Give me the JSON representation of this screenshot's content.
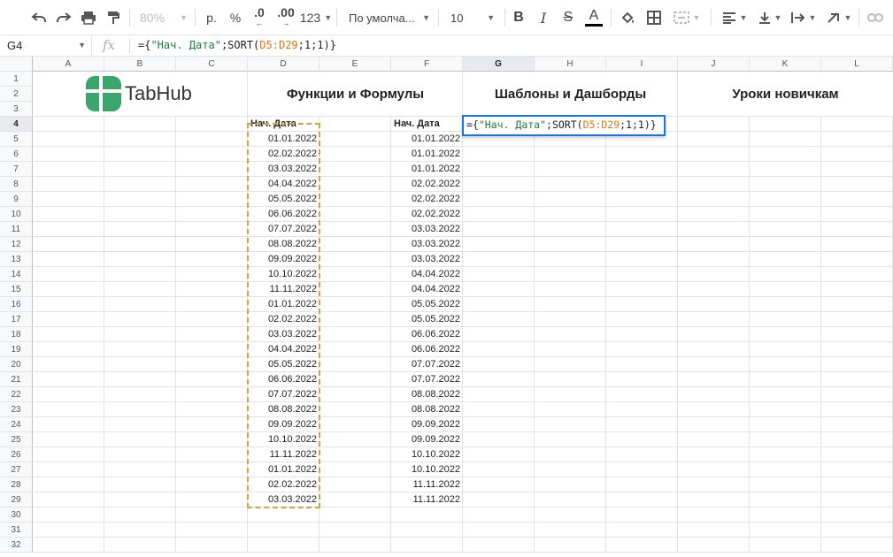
{
  "toolbar": {
    "zoom": "80%",
    "currency": "р.",
    "percent": "%",
    "decrease_decimal": ".0",
    "increase_decimal": ".00",
    "number_format": "123",
    "font_name": "По умолча...",
    "font_size": "10",
    "bold": "B",
    "italic": "I",
    "strikethrough": "S",
    "text_color_letter": "A"
  },
  "formula_bar": {
    "cell_ref": "G4",
    "fx": "fx",
    "formula_prefix": "={",
    "formula_string": "\"Нач. Дата\"",
    "formula_mid": ";SORT(",
    "formula_range": "D5:D29",
    "formula_suffix": ";1;1)}"
  },
  "columns": [
    "A",
    "B",
    "C",
    "D",
    "E",
    "F",
    "G",
    "H",
    "I",
    "J",
    "K",
    "L"
  ],
  "selected_column": "G",
  "selected_row": "4",
  "rows": [
    "1",
    "2",
    "3",
    "4",
    "5",
    "6",
    "7",
    "8",
    "9",
    "10",
    "11",
    "12",
    "13",
    "14",
    "15",
    "16",
    "17",
    "18",
    "19",
    "20",
    "21",
    "22",
    "23",
    "24",
    "25",
    "26",
    "27",
    "28",
    "29",
    "30",
    "31",
    "32"
  ],
  "banner": {
    "logo_text": "TabHub",
    "link1": "Функции и Формулы",
    "link2": "Шаблоны и Дашборды",
    "link3": "Уроки новичкам"
  },
  "header_d": "Нач. Дата",
  "header_f": "Нач. Дата",
  "col_d": [
    "01.01.2022",
    "02.02.2022",
    "03.03.2022",
    "04.04.2022",
    "05.05.2022",
    "06.06.2022",
    "07.07.2022",
    "08.08.2022",
    "09.09.2022",
    "10.10.2022",
    "11.11.2022",
    "01.01.2022",
    "02.02.2022",
    "03.03.2022",
    "04.04.2022",
    "05.05.2022",
    "06.06.2022",
    "07.07.2022",
    "08.08.2022",
    "09.09.2022",
    "10.10.2022",
    "11.11.2022",
    "01.01.2022",
    "02.02.2022",
    "03.03.2022"
  ],
  "col_f": [
    "01.01.2022",
    "01.01.2022",
    "01.01.2022",
    "02.02.2022",
    "02.02.2022",
    "02.02.2022",
    "03.03.2022",
    "03.03.2022",
    "03.03.2022",
    "04.04.2022",
    "04.04.2022",
    "05.05.2022",
    "05.05.2022",
    "06.06.2022",
    "06.06.2022",
    "07.07.2022",
    "07.07.2022",
    "08.08.2022",
    "08.08.2022",
    "09.09.2022",
    "09.09.2022",
    "10.10.2022",
    "10.10.2022",
    "11.11.2022",
    "11.11.2022"
  ],
  "editor": {
    "prefix": "={",
    "string": "\"Нач. Дата\"",
    "mid": ";SORT(",
    "range": "D5:D29",
    "suffix": ";1;1)}"
  },
  "colors": {
    "accent": "#1a73e8",
    "logo_green": "#3aa66b",
    "copy_border": "#d6a23a",
    "formula_string": "#188038",
    "formula_range": "#e8710a"
  }
}
